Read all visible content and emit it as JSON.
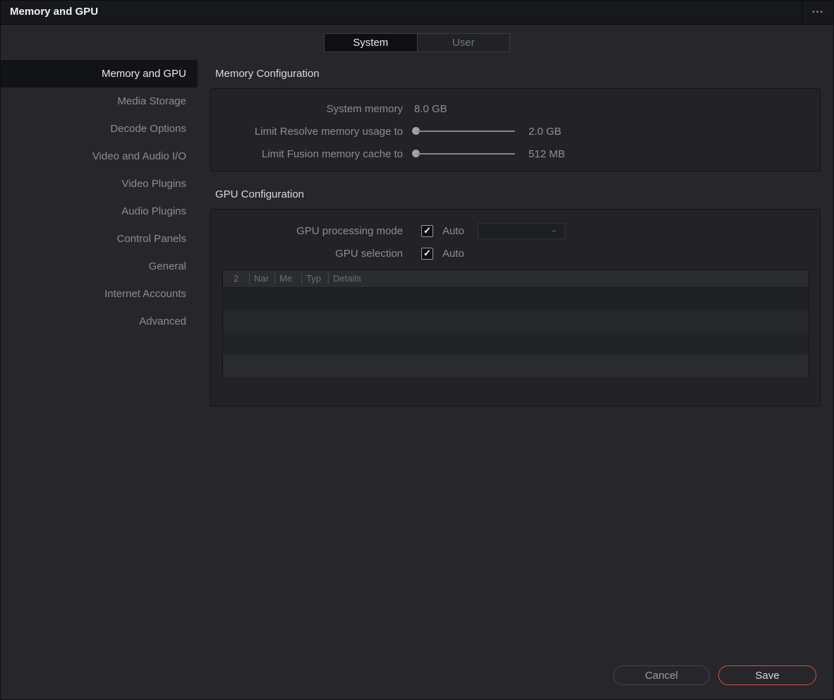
{
  "window": {
    "title": "Memory and GPU"
  },
  "icons": {
    "ellipsis": "•••",
    "chevron_down": "⌄",
    "checkmark": "✓"
  },
  "tabs": [
    {
      "label": "System",
      "active": true
    },
    {
      "label": "User",
      "active": false
    }
  ],
  "sidebar": {
    "items": [
      {
        "label": "Memory and GPU",
        "selected": true
      },
      {
        "label": "Media Storage",
        "selected": false
      },
      {
        "label": "Decode Options",
        "selected": false
      },
      {
        "label": "Video and Audio I/O",
        "selected": false
      },
      {
        "label": "Video Plugins",
        "selected": false
      },
      {
        "label": "Audio Plugins",
        "selected": false
      },
      {
        "label": "Control Panels",
        "selected": false
      },
      {
        "label": "General",
        "selected": false
      },
      {
        "label": "Internet Accounts",
        "selected": false
      },
      {
        "label": "Advanced",
        "selected": false
      }
    ]
  },
  "memory_configuration": {
    "title": "Memory Configuration",
    "system_memory": {
      "label": "System memory",
      "value": "8.0 GB"
    },
    "limit_resolve": {
      "label": "Limit Resolve memory usage to",
      "value": "2.0 GB"
    },
    "limit_fusion": {
      "label": "Limit Fusion memory cache to",
      "value": "512 MB"
    }
  },
  "gpu_configuration": {
    "title": "GPU Configuration",
    "processing_mode": {
      "label": "GPU processing mode",
      "auto_label": "Auto",
      "checked": true,
      "selected_value": ""
    },
    "gpu_selection": {
      "label": "GPU selection",
      "auto_label": "Auto",
      "checked": true
    },
    "table": {
      "columns": [
        "2",
        "Nar",
        "Me",
        "Typ",
        "Details"
      ],
      "rows": []
    }
  },
  "footer": {
    "cancel_label": "Cancel",
    "save_label": "Save"
  },
  "colors": {
    "accent_red": "#dd4f3b",
    "page_bg": "#27272b",
    "titlebar_bg": "#17181c",
    "selection_bg": "#121316",
    "active_tab_bg": "#0e0f12"
  }
}
